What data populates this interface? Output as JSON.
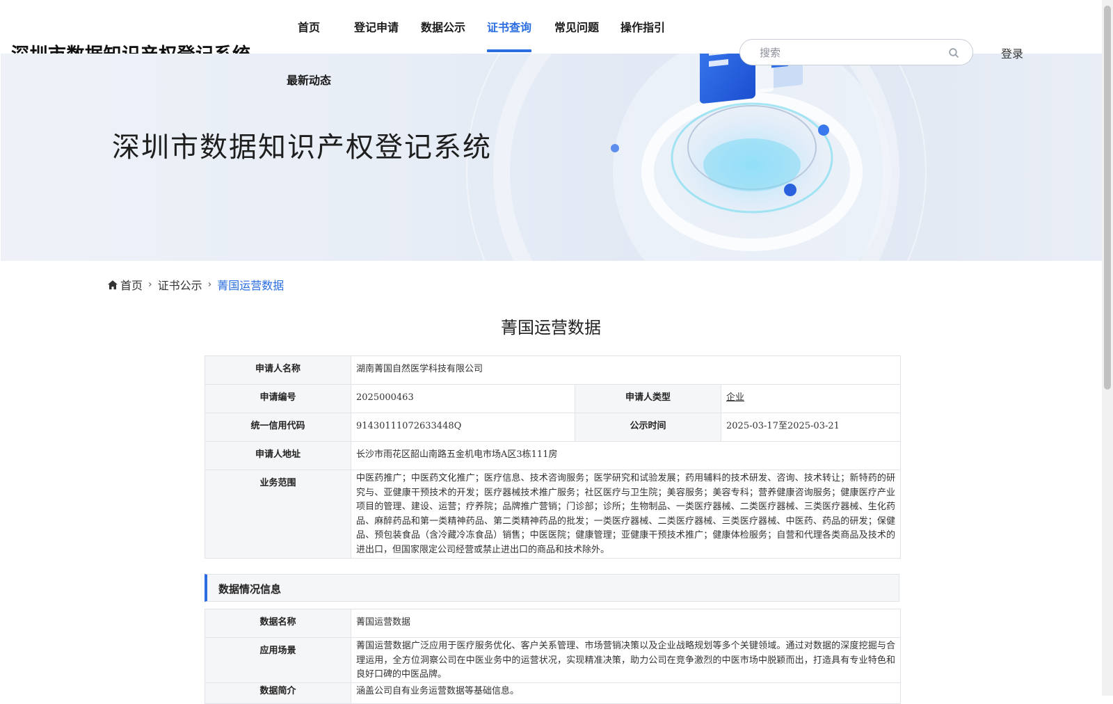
{
  "header": {
    "site_title": "深圳市数据知识产权登记系统",
    "nav": [
      {
        "label": "首页"
      },
      {
        "label": "登记申请"
      },
      {
        "label": "数据公示"
      },
      {
        "label": "证书查询"
      },
      {
        "label": "常见问题"
      },
      {
        "label": "操作指引"
      },
      {
        "label": "最新动态"
      }
    ],
    "active_nav": "证书查询",
    "search_placeholder": "搜索",
    "login_label": "登录",
    "accent_color": "#2a6de0"
  },
  "banner": {
    "title": "深圳市数据知识产权登记系统"
  },
  "breadcrumb": {
    "home": "首页",
    "level1": "证书公示",
    "current": "菁国运营数据"
  },
  "page_title": "菁国运营数据",
  "applicant": {
    "name_label": "申请人名称",
    "name": "湖南菁国自然医学科技有限公司",
    "number_label": "申请编号",
    "number": "2025000463",
    "type_label": "申请人类型",
    "type": "企业",
    "credit_label": "统一信用代码",
    "credit": "91430111072633448Q",
    "period_label": "公示时间",
    "period": "2025-03-17至2025-03-21",
    "address_label": "申请人地址",
    "address": "长沙市雨花区韶山南路五金机电市场A区3栋111房",
    "scope_label": "业务范围",
    "scope": "中医药推广；中医药文化推广；医疗信息、技术咨询服务；医学研究和试验发展；药用辅料的技术研发、咨询、技术转让；新特药的研究与、亚健康干预技术的开发；医疗器械技术推广服务；社区医疗与卫生院；美容服务；美容专科；营养健康咨询服务；健康医疗产业项目的管理、建设、运营；疗养院；品牌推广营销；门诊部；诊所；生物制品、一类医疗器械、二类医疗器械、三类医疗器械、生化药品、麻醉药品和第一类精神药品、第二类精神药品的批发；一类医疗器械、二类医疗器械、三类医疗器械、中医药、药品的研发；保健品、预包装食品（含冷藏冷冻食品）销售；中医医院；健康管理；亚健康干预技术推广；健康体检服务；自营和代理各类商品及技术的进出口，但国家限定公司经营或禁止进出口的商品和技术除外。"
  },
  "data_section": {
    "title": "数据情况信息",
    "data_name_label": "数据名称",
    "data_name": "菁国运营数据",
    "scenario_label": "应用场景",
    "scenario": "菁国运营数据广泛应用于医疗服务优化、客户关系管理、市场营销决策以及企业战略规划等多个关键领域。通过对数据的深度挖掘与合理运用，全方位洞察公司在中医业务中的运营状况，实现精准决策，助力公司在竞争激烈的中医市场中脱颖而出，打造具有专业特色和良好口碑的中医品牌。",
    "summary_label": "数据简介",
    "summary": "涵盖公司自有业务运营数据等基础信息。"
  }
}
